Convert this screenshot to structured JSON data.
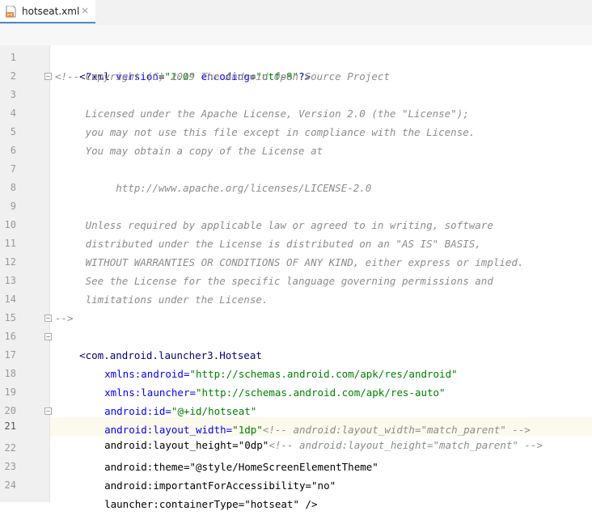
{
  "tab": {
    "filename": "hotseat.xml",
    "close": "×"
  },
  "line_numbers": [
    "1",
    "2",
    "3",
    "4",
    "5",
    "6",
    "7",
    "8",
    "9",
    "10",
    "11",
    "12",
    "13",
    "14",
    "15",
    "16",
    "17",
    "18",
    "19",
    "20",
    "21",
    "22",
    "23",
    "24"
  ],
  "active_line": "21",
  "code": {
    "l1": {
      "a": "<?xml ",
      "b": "version",
      "c": "=",
      "d": "\"1.0\"",
      "e": " ",
      "f": "encoding",
      "g": "=",
      "h": "\"utf-8\"",
      "i": "?>"
    },
    "l2": "<!-- Copyright (C) 2019 The Android Open Source Project",
    "l4": "     Licensed under the Apache License, Version 2.0 (the \"License\");",
    "l5": "     you may not use this file except in compliance with the License.",
    "l6": "     You may obtain a copy of the License at",
    "l8": "          http://www.apache.org/licenses/LICENSE-2.0",
    "l10": "     Unless required by applicable law or agreed to in writing, software",
    "l11": "     distributed under the License is distributed on an \"AS IS\" BASIS,",
    "l12": "     WITHOUT WARRANTIES OR CONDITIONS OF ANY KIND, either express or implied.",
    "l13": "     See the License for the specific language governing permissions and",
    "l14": "     limitations under the License.",
    "l15": "-->",
    "l16": {
      "open": "<com.android.launcher3.Hotseat"
    },
    "l17": {
      "ns": "xmlns",
      "colon": ":",
      "attr": "android",
      "eq": "=",
      "val": "\"http://schemas.android.com/apk/res/android\""
    },
    "l18": {
      "ns": "xmlns",
      "colon": ":",
      "attr": "launcher",
      "eq": "=",
      "val": "\"http://schemas.android.com/apk/res-auto\""
    },
    "l19": {
      "ns": "android",
      "colon": ":",
      "attr": "id",
      "eq": "=",
      "val": "\"@+id/hotseat\""
    },
    "l20": {
      "ns": "android",
      "colon": ":",
      "attr": "layout_width",
      "eq": "=",
      "val": "\"1dp\"",
      "comment": "<!-- android:layout_width=\"match_parent\" -->"
    },
    "l21": {
      "ns": "android",
      "colon": ":",
      "attr": "layout_height",
      "eq": "=",
      "val": "\"0dp\"",
      "comment": "<!-- android:layout_height=\"match_parent\" -->"
    },
    "l22": {
      "ns": "android",
      "colon": ":",
      "attr": "theme",
      "eq": "=",
      "val": "\"@style/HomeScreenElementTheme\""
    },
    "l23": {
      "ns": "android",
      "colon": ":",
      "attr": "importantForAccessibility",
      "eq": "=",
      "val": "\"no\""
    },
    "l24": {
      "ns": "launcher",
      "colon": ":",
      "attr": "containerType",
      "eq": "=",
      "val": "\"hotseat\"",
      "close": " />"
    }
  }
}
